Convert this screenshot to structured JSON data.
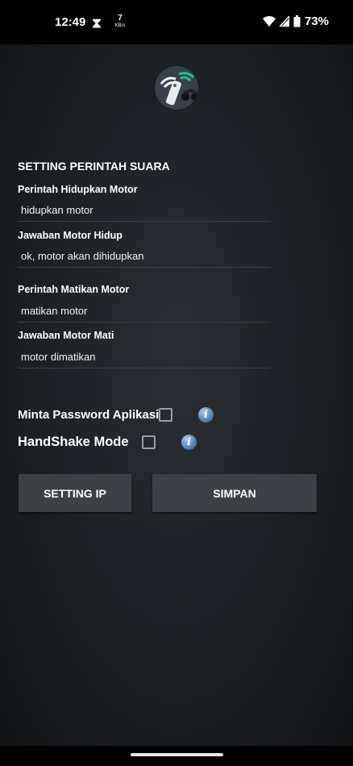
{
  "status_bar": {
    "time": "12:49",
    "speed_value": "7",
    "speed_unit": "KB/s",
    "battery": "73%"
  },
  "settings": {
    "title": "SETTING PERINTAH SUARA",
    "fields": [
      {
        "label": "Perintah Hidupkan Motor",
        "value": "hidupkan motor"
      },
      {
        "label": "Jawaban Motor Hidup",
        "value": "ok, motor akan dihidupkan"
      },
      {
        "label": "Perintah Matikan Motor",
        "value": "matikan motor"
      },
      {
        "label": "Jawaban Motor Mati",
        "value": "motor dimatikan"
      }
    ],
    "options": [
      {
        "label": "Minta Password Aplikasi",
        "checked": false
      },
      {
        "label": "HandShake Mode",
        "checked": false
      }
    ]
  },
  "buttons": {
    "setting_ip": "SETTING IP",
    "save": "SIMPAN"
  },
  "icons": {
    "info": "i"
  },
  "colors": {
    "background": "#1d2024",
    "button": "#3d4146",
    "info_icon": "#5b87b8"
  }
}
